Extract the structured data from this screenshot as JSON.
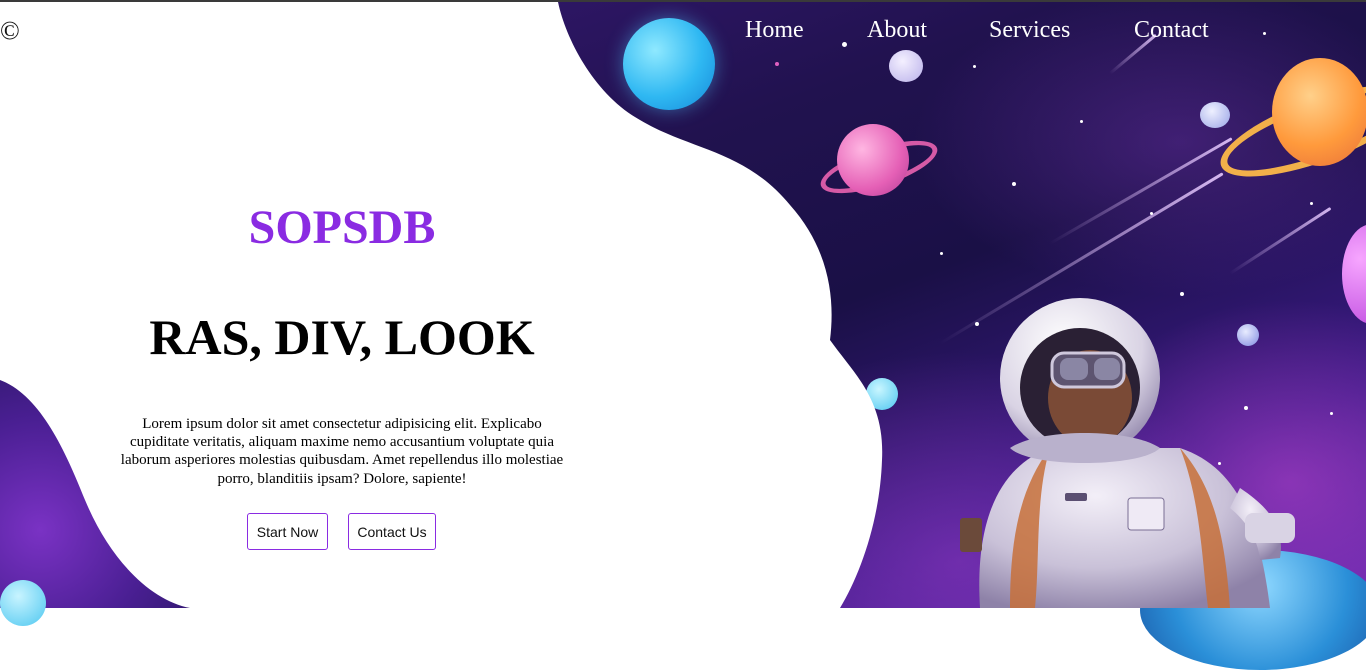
{
  "logo": {
    "symbol": "©",
    "icon": "copyright-icon"
  },
  "nav": {
    "items": [
      {
        "label": "Home"
      },
      {
        "label": "About"
      },
      {
        "label": "Services"
      },
      {
        "label": "Contact"
      }
    ]
  },
  "hero": {
    "brand": "SOPSDB",
    "headline": "RAS, DIV, LOOK",
    "paragraph": "Lorem ipsum dolor sit amet consectetur adipisicing elit. Explicabo cupiditate veritatis, aliquam maxime nemo accusantium voluptate quia laborum asperiores molestias quibusdam. Amet repellendus illo molestiae porro, blanditiis ipsam? Dolore, sapiente!",
    "buttons": {
      "start": "Start Now",
      "contact": "Contact Us"
    }
  },
  "colors": {
    "brand": "#8a2be2",
    "nav_text": "#ffffff",
    "space_dark": "#1a1046",
    "space_purple": "#6a2ab0"
  },
  "illustration": {
    "subject": "astronaut-illustration",
    "background": "space-illustration"
  }
}
